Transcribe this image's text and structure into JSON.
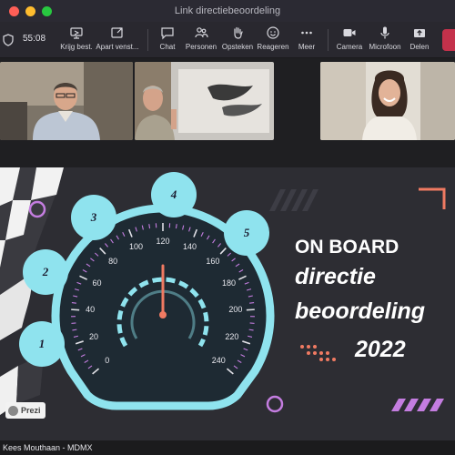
{
  "window": {
    "title": "Link directiebeoordeling"
  },
  "toolbar": {
    "timer": "55:08",
    "items": [
      {
        "label": "Krijg best.",
        "icon": "screen-share-icon"
      },
      {
        "label": "Apart venst...",
        "icon": "pop-out-icon"
      },
      {
        "label": "Chat",
        "icon": "chat-icon"
      },
      {
        "label": "Personen",
        "icon": "people-icon"
      },
      {
        "label": "Opsteken",
        "icon": "raise-hand-icon"
      },
      {
        "label": "Reageren",
        "icon": "react-icon"
      },
      {
        "label": "Meer",
        "icon": "more-icon"
      },
      {
        "label": "Camera",
        "icon": "camera-icon"
      },
      {
        "label": "Microfoon",
        "icon": "microphone-icon"
      },
      {
        "label": "Delen",
        "icon": "share-icon"
      }
    ]
  },
  "slide": {
    "line1": "ON BOARD",
    "line2": "directie",
    "line3": "beoordeling",
    "line4": "2022",
    "bubbles": [
      "1",
      "2",
      "3",
      "4",
      "5"
    ],
    "gauge_ticks": [
      "0",
      "20",
      "40",
      "60",
      "80",
      "100",
      "120",
      "140",
      "160",
      "180",
      "200",
      "220",
      "240"
    ],
    "gauge_value": 120,
    "prezi_label": "Prezi"
  },
  "footer": {
    "presenter": "Kees Mouthaan - MDMX"
  },
  "colors": {
    "accent_cyan": "#8fe3ee",
    "accent_purple": "#c47de0",
    "accent_coral": "#f07a62",
    "leave_red": "#c4314b"
  }
}
